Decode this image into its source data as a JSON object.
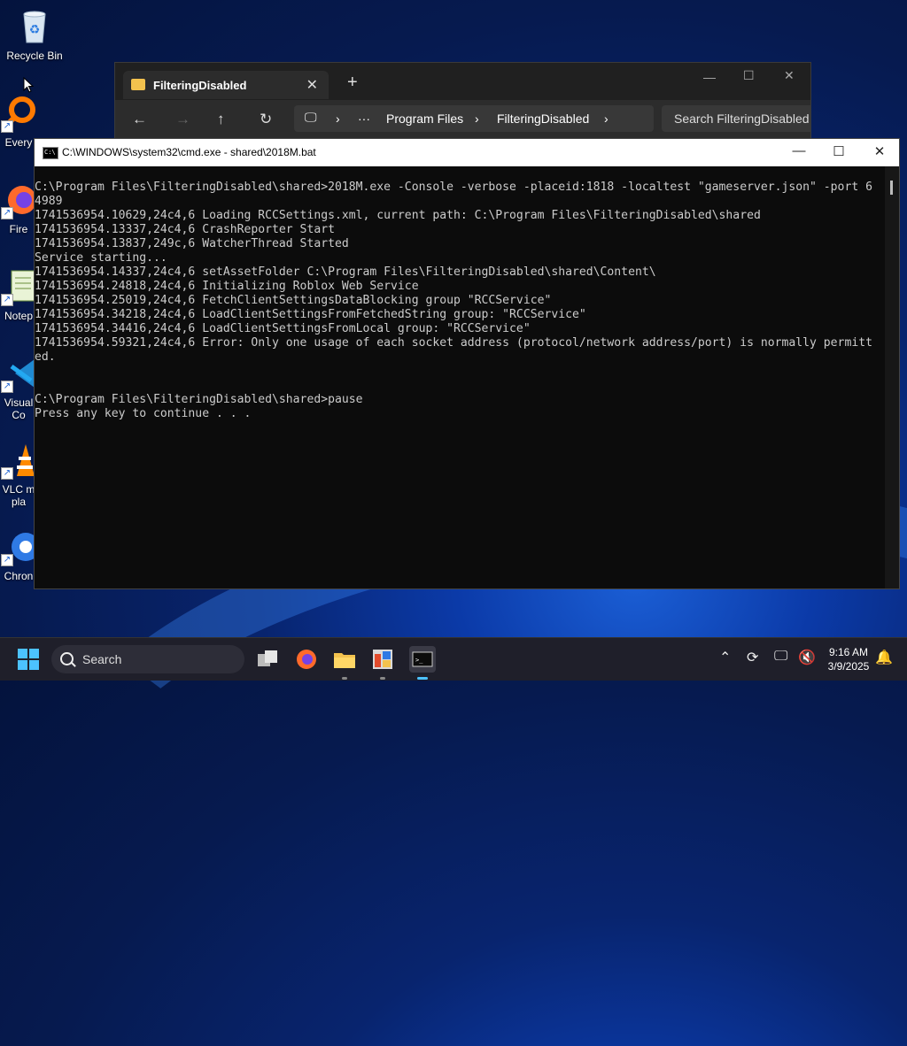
{
  "desktop": {
    "icons": [
      {
        "label": "Recycle Bin"
      },
      {
        "label": "Every"
      },
      {
        "label": "Fire"
      },
      {
        "label": "Notep"
      },
      {
        "label": "Visual\nCo"
      },
      {
        "label": "VLC m\npla"
      },
      {
        "label": "Chron"
      }
    ]
  },
  "explorer": {
    "tab_title": "FilteringDisabled",
    "tab_close": "✕",
    "new_tab": "+",
    "breadcrumb": {
      "more": "···",
      "items": [
        "Program Files",
        "FilteringDisabled"
      ]
    },
    "search_placeholder": "Search FilteringDisabled",
    "controls": {
      "min": "—",
      "max": "☐",
      "close": "✕"
    }
  },
  "cmd": {
    "title": "C:\\WINDOWS\\system32\\cmd.exe - shared\\2018M.bat",
    "controls": {
      "min": "—",
      "max": "☐",
      "close": "✕"
    },
    "lines": [
      "C:\\Program Files\\FilteringDisabled\\shared>2018M.exe -Console -verbose -placeid:1818 -localtest \"gameserver.json\" -port 6",
      "4989",
      "1741536954.10629,24c4,6 Loading RCCSettings.xml, current path: C:\\Program Files\\FilteringDisabled\\shared",
      "1741536954.13337,24c4,6 CrashReporter Start",
      "1741536954.13837,249c,6 WatcherThread Started",
      "Service starting...",
      "1741536954.14337,24c4,6 setAssetFolder C:\\Program Files\\FilteringDisabled\\shared\\Content\\",
      "1741536954.24818,24c4,6 Initializing Roblox Web Service",
      "1741536954.25019,24c4,6 FetchClientSettingsDataBlocking group \"RCCService\"",
      "1741536954.34218,24c4,6 LoadClientSettingsFromFetchedString group: \"RCCService\"",
      "1741536954.34416,24c4,6 LoadClientSettingsFromLocal group: \"RCCService\"",
      "1741536954.59321,24c4,6 Error: Only one usage of each socket address (protocol/network address/port) is normally permitt",
      "ed.",
      "",
      "",
      "C:\\Program Files\\FilteringDisabled\\shared>pause",
      "Press any key to continue . . ."
    ]
  },
  "taskbar": {
    "search_label": "Search",
    "time": "9:16 AM",
    "date": "3/9/2025"
  },
  "colors": {
    "console_bg": "#0c0c0c",
    "console_text": "#cccccc",
    "taskbar_bg": "#1f1f2a"
  }
}
